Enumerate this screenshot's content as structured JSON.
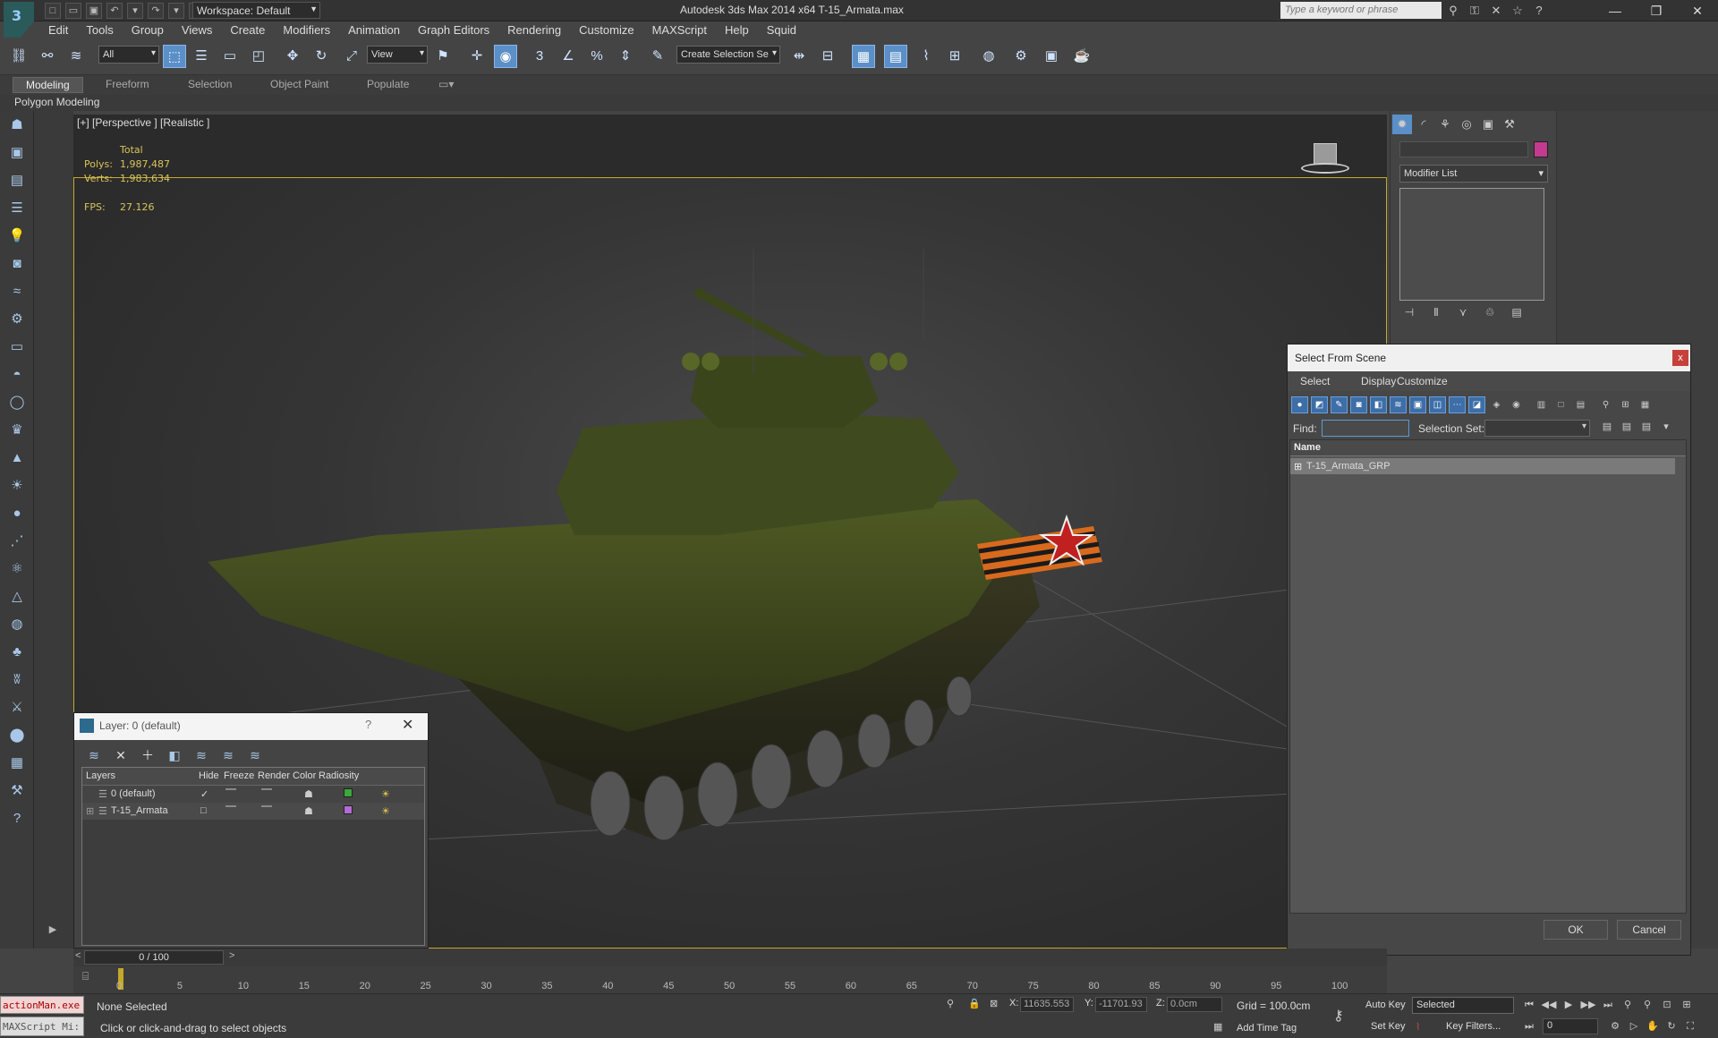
{
  "titlebar": {
    "workspace": "Workspace: Default",
    "app_title": "Autodesk 3ds Max  2014 x64      T-15_Armata.max",
    "search_placeholder": "Type a keyword or phrase"
  },
  "menu": [
    "Edit",
    "Tools",
    "Group",
    "Views",
    "Create",
    "Modifiers",
    "Animation",
    "Graph Editors",
    "Rendering",
    "Customize",
    "MAXScript",
    "Help",
    "Squid"
  ],
  "toolbar": {
    "selection_filter": "All",
    "ref_coord": "View",
    "named_selection": "Create Selection Se"
  },
  "ribbon": {
    "tabs": [
      "Modeling",
      "Freeform",
      "Selection",
      "Object Paint",
      "Populate"
    ],
    "active_tab": "Modeling",
    "panel": "Polygon Modeling"
  },
  "viewport": {
    "label": "[+] [Perspective ] [Realistic ]",
    "stats_header": "Total",
    "polys_label": "Polys:",
    "polys": "1,987,487",
    "verts_label": "Verts:",
    "verts": "1,983,634",
    "fps_label": "FPS:",
    "fps": "27.126"
  },
  "layer_window": {
    "title": "Layer: 0 (default)",
    "help": "?",
    "columns": [
      "Layers",
      "Hide",
      "Freeze",
      "Render",
      "Color",
      "Radiosity"
    ],
    "rows": [
      {
        "name": "0 (default)",
        "color": "#3aa83a",
        "current": true
      },
      {
        "name": "T-15_Armata",
        "color": "#b36ad4",
        "current": false
      }
    ]
  },
  "command_panel": {
    "modifier_list": "Modifier List",
    "object_color": "#c43a8e"
  },
  "select_from_scene": {
    "title": "Select From Scene",
    "close": "x",
    "menu": [
      "Select",
      "Display",
      "Customize"
    ],
    "find_label": "Find:",
    "selection_set_label": "Selection Set:",
    "column_name": "Name",
    "items": [
      "T-15_Armata_GRP"
    ],
    "ok": "OK",
    "cancel": "Cancel"
  },
  "timeline": {
    "frame_display": "0 / 100",
    "ticks": [
      "0",
      "5",
      "10",
      "15",
      "20",
      "25",
      "30",
      "35",
      "40",
      "45",
      "50",
      "55",
      "60",
      "65",
      "70",
      "75",
      "80",
      "85",
      "90",
      "95",
      "100"
    ]
  },
  "status": {
    "maxscript_line1": "actionMan.exe",
    "maxscript_line2": "MAXScript Mi:",
    "selection": "None Selected",
    "prompt": "Click or click-and-drag to select objects",
    "x_label": "X:",
    "x_value": "11635.553",
    "y_label": "Y:",
    "y_value": "-11701.93",
    "z_label": "Z:",
    "z_value": "0.0cm",
    "grid": "Grid = 100.0cm",
    "add_time_tag": "Add Time Tag",
    "auto_key": "Auto Key",
    "set_key": "Set Key",
    "selected_dd": "Selected",
    "key_filters": "Key Filters...",
    "current_frame": "0"
  },
  "colors": {
    "accent": "#5b8fc7",
    "viewport_frame": "#c4a82a",
    "stats_text": "#d8c45a"
  }
}
